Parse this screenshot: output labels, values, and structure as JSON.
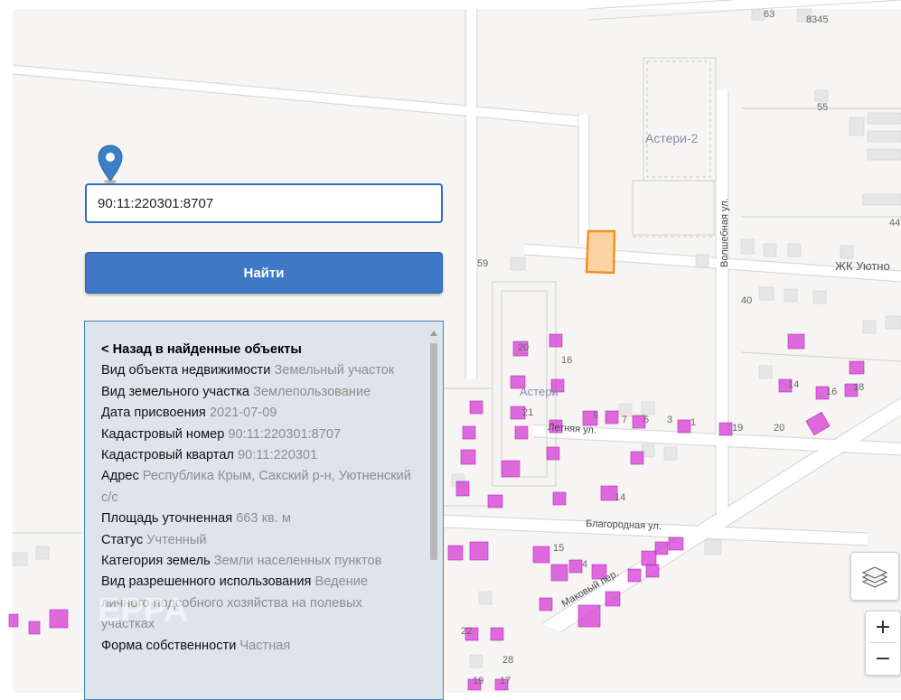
{
  "map": {
    "street_labels": [
      "Волшебная ул.",
      "Летняя ул.",
      "Благородная ул.",
      "Маковый пер."
    ],
    "area_labels": [
      "Астери-2",
      "Астери",
      "ЖК Уютно"
    ],
    "house_numbers": [
      "63",
      "8345",
      "55",
      "59",
      "40",
      "20",
      "16",
      "44",
      "14",
      "16",
      "18",
      "21",
      "9",
      "7",
      "5",
      "3",
      "1",
      "19",
      "20",
      "14",
      "15",
      "4",
      "22",
      "28",
      "19",
      "17"
    ],
    "colors": {
      "background": "#f6f5f3",
      "road": "#ffffff",
      "building": "#e3e3e3",
      "highlight": "#d63ad6",
      "selected_parcel_border": "#f0921e",
      "selected_parcel_fill": "#fbd3a3"
    }
  },
  "search": {
    "value": "90:11:220301:8707"
  },
  "find_button": {
    "label": "Найти"
  },
  "pin_icon": "map-marker",
  "info": {
    "back_link": "< Назад в найденные объекты",
    "rows": [
      {
        "label": "Вид объекта недвижимости",
        "value": "Земельный участок"
      },
      {
        "label": "Вид земельного участка",
        "value": "Землепользование"
      },
      {
        "label": "Дата присвоения",
        "value": "2021-07-09"
      },
      {
        "label": "Кадастровый номер",
        "value": "90:11:220301:8707"
      },
      {
        "label": "Кадастровый квартал",
        "value": "90:11:220301"
      },
      {
        "label": "Адрес",
        "value": "Республика Крым, Сакский р-н, Уютненский с/с"
      },
      {
        "label": "Площадь уточненная",
        "value": "663 кв. м"
      },
      {
        "label": "Статус",
        "value": "Учтенный"
      },
      {
        "label": "Категория земель",
        "value": "Земли населенных пунктов"
      },
      {
        "label": "Вид разрешенного использования",
        "value": "Ведение личного подсобного хозяйства на полевых участках"
      },
      {
        "label": "Форма собственности",
        "value": "Частная"
      }
    ]
  },
  "controls": {
    "layers_icon": "layers-icon",
    "zoom_in": "+",
    "zoom_out": "−"
  },
  "watermark": {
    "text": "ЕРРА"
  }
}
